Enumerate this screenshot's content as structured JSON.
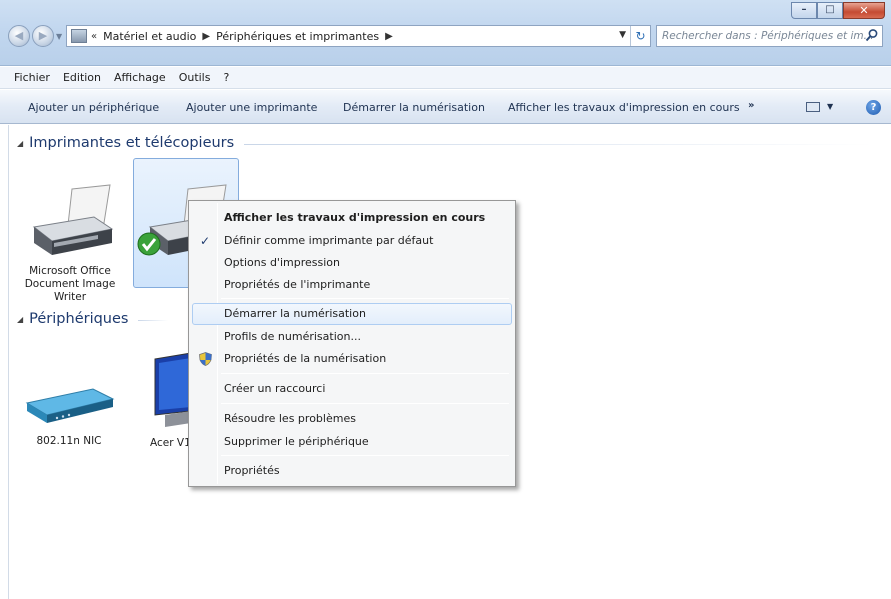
{
  "window": {
    "min_glyph": "–",
    "max_glyph": "□",
    "close_glyph": "✕"
  },
  "address": {
    "overflow": "«",
    "crumbs": [
      "Matériel et audio",
      "Périphériques et imprimantes"
    ],
    "search_placeholder": "Rechercher dans : Périphériques et im..."
  },
  "menubar": [
    "Fichier",
    "Edition",
    "Affichage",
    "Outils",
    "?"
  ],
  "commands": {
    "add_device": "Ajouter un périphérique",
    "add_printer": "Ajouter une imprimante",
    "start_scan": "Démarrer la numérisation",
    "show_jobs": "Afficher les travaux d'impression en cours",
    "more": "»"
  },
  "groups": {
    "printers": "Imprimantes et télécopieurs",
    "devices": "Périphériques"
  },
  "devices": {
    "printer1": [
      "Microsoft Office",
      "Document Image",
      "Writer"
    ],
    "nic": "802.11n NIC",
    "monitor": "Acer V1"
  },
  "context_menu": [
    "Afficher les travaux d'impression en cours",
    "Définir comme imprimante par défaut",
    "Options d'impression",
    "Propriétés de l'imprimante",
    "Démarrer la numérisation",
    "Profils de numérisation...",
    "Propriétés de la numérisation",
    "Créer un raccourci",
    "Résoudre les problèmes",
    "Supprimer le périphérique",
    "Propriétés"
  ],
  "colors": {
    "accent": "#1e3a6e",
    "selection": "#cfe4fb",
    "default_check": "#3aa23a"
  }
}
